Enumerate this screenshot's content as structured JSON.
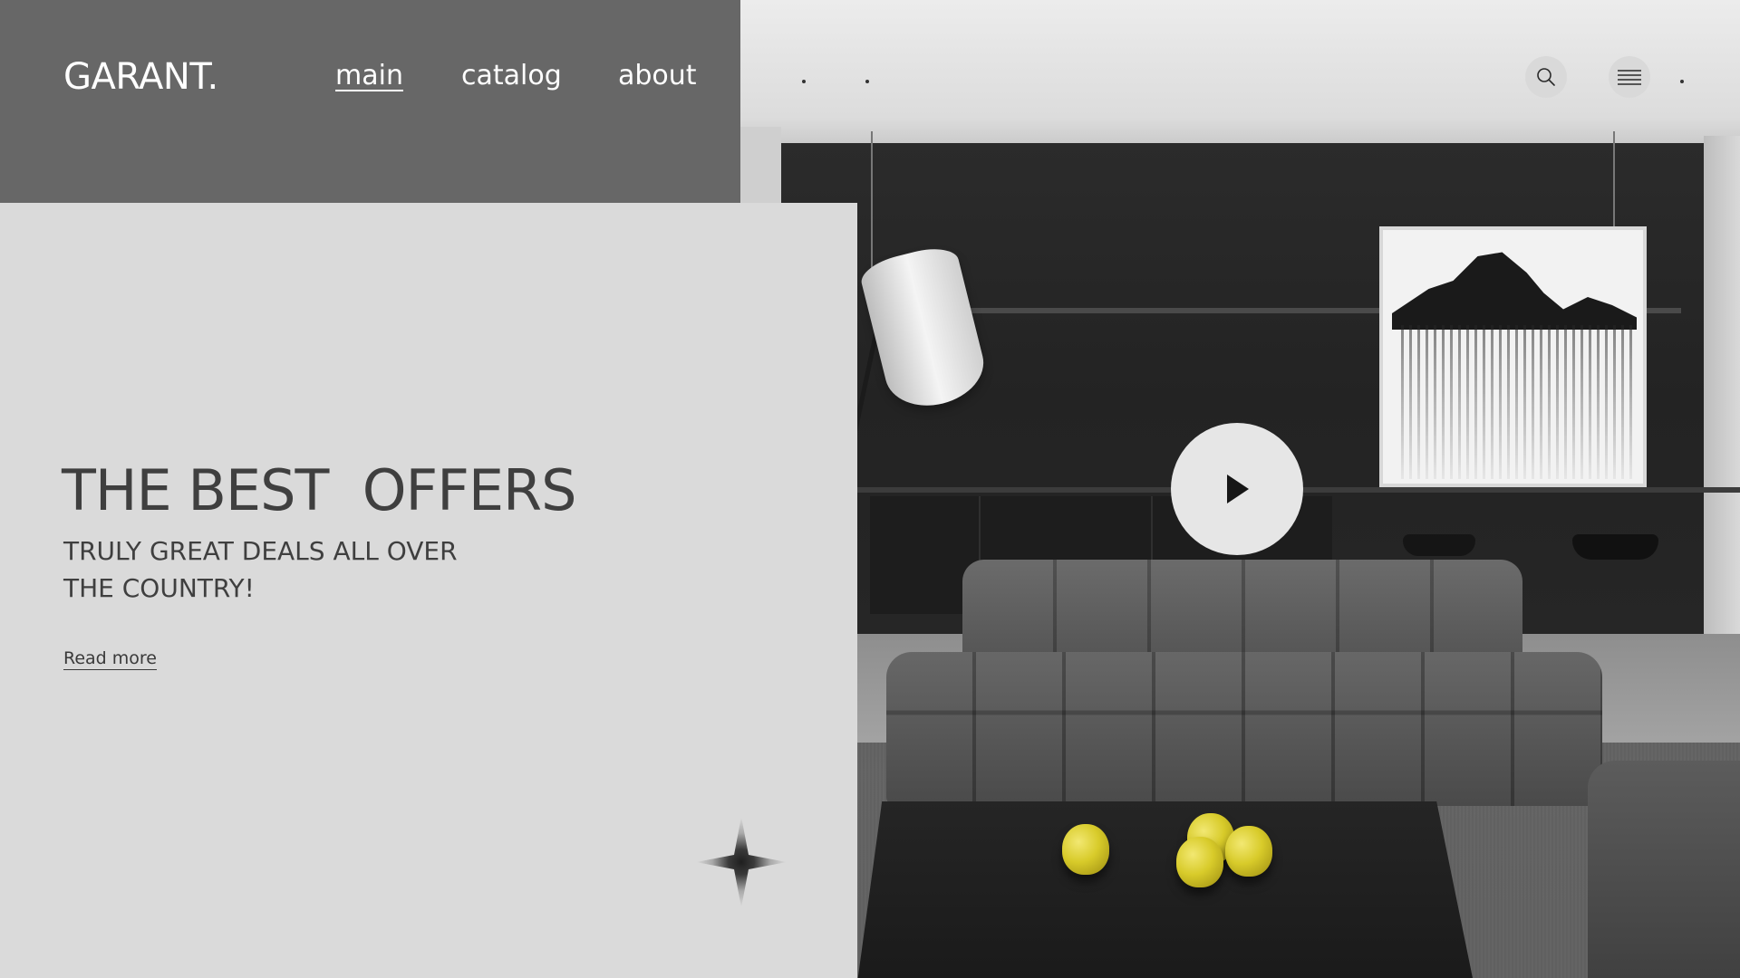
{
  "brand": {
    "logo_text": "GARANT."
  },
  "nav": {
    "items": [
      {
        "label": "main",
        "active": true
      },
      {
        "label": "catalog",
        "active": false
      },
      {
        "label": "about",
        "active": false
      }
    ]
  },
  "header_actions": {
    "search_icon": "search-icon",
    "menu_icon": "hamburger-menu-icon"
  },
  "hero": {
    "title": "THE BEST  OFFERS",
    "subtitle": "TRULY GREAT DEALS ALL OVER THE COUNTRY!",
    "cta_label": "Read more"
  },
  "video": {
    "play_icon": "play-icon"
  },
  "colors": {
    "header_bg": "#676767",
    "hero_bg": "#dadada",
    "text_dark": "#3f3f3f",
    "text_light": "#ffffff"
  }
}
